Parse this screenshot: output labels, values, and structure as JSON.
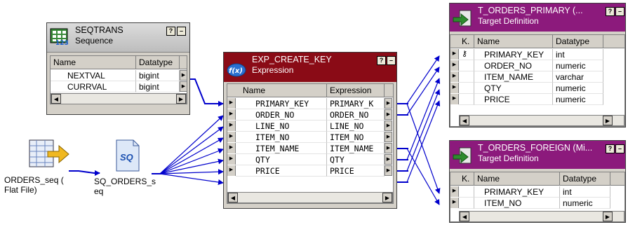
{
  "seqtrans": {
    "title": "SEQTRANS",
    "subtitle": "Sequence",
    "columns": [
      "Name",
      "Datatype"
    ],
    "rows": [
      {
        "name": "NEXTVAL",
        "datatype": "bigint"
      },
      {
        "name": "CURRVAL",
        "datatype": "bigint"
      }
    ]
  },
  "expression": {
    "title": "EXP_CREATE_KEY",
    "subtitle": "Expression",
    "columns": [
      "Name",
      "Expression"
    ],
    "rows": [
      {
        "name": "PRIMARY_KEY",
        "expr": "PRIMARY_K"
      },
      {
        "name": "ORDER_NO",
        "expr": "ORDER_NO"
      },
      {
        "name": "LINE_NO",
        "expr": "LINE_NO"
      },
      {
        "name": "ITEM_NO",
        "expr": "ITEM_NO"
      },
      {
        "name": "ITEM_NAME",
        "expr": "ITEM_NAME"
      },
      {
        "name": "QTY",
        "expr": "QTY"
      },
      {
        "name": "PRICE",
        "expr": "PRICE"
      }
    ]
  },
  "target_primary": {
    "title": "T_ORDERS_PRIMARY (...",
    "subtitle": "Target Definition",
    "columns": [
      "K.",
      "Name",
      "Datatype"
    ],
    "rows": [
      {
        "name": "PRIMARY_KEY",
        "datatype": "int"
      },
      {
        "name": "ORDER_NO",
        "datatype": "numeric"
      },
      {
        "name": "ITEM_NAME",
        "datatype": "varchar"
      },
      {
        "name": "QTY",
        "datatype": "numeric"
      },
      {
        "name": "PRICE",
        "datatype": "numeric"
      }
    ]
  },
  "target_foreign": {
    "title": "T_ORDERS_FOREIGN (Mi...",
    "subtitle": "Target Definition",
    "columns": [
      "K.",
      "Name",
      "Datatype"
    ],
    "rows": [
      {
        "name": "PRIMARY_KEY",
        "datatype": "int"
      },
      {
        "name": "ITEM_NO",
        "datatype": "numeric"
      }
    ]
  },
  "source": {
    "label_line1": "ORDERS_seq (",
    "label_line2": "Flat File)"
  },
  "source_qualifier": {
    "label_line1": "SQ_ORDERS_s",
    "label_line2": "eq",
    "icon_text": "SQ"
  },
  "colors": {
    "expression_header": "#8a0b16",
    "target_header": "#8c1a7c",
    "link_color": "#0000cc"
  },
  "icons": {
    "sequence": "sequence-grid-icon",
    "expression": "expression-flow-icon",
    "target": "target-arrow-icon",
    "source": "flat-file-source-icon",
    "source_qualifier": "sq-document-icon",
    "primary_key": "key-icon"
  }
}
